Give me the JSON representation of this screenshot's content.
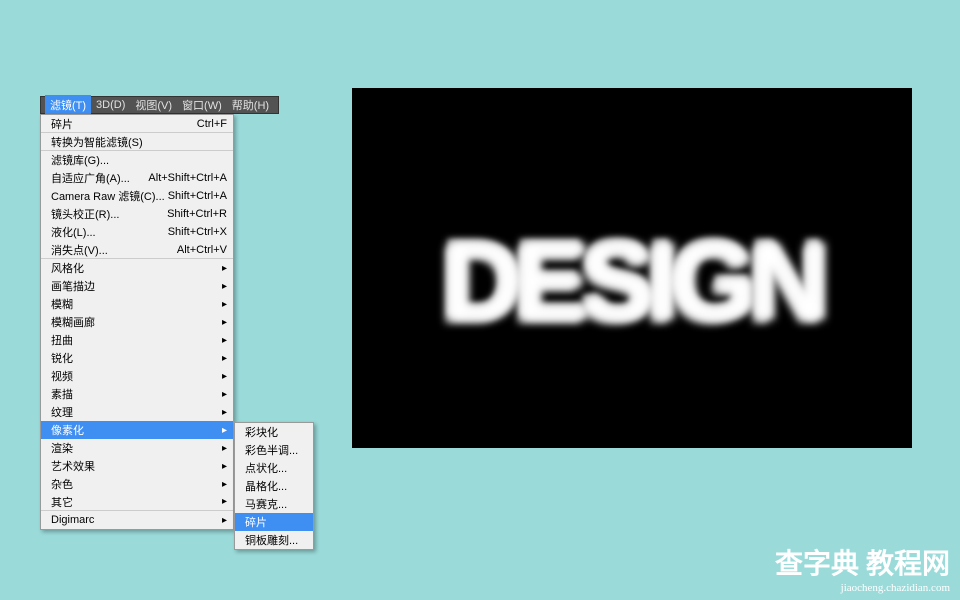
{
  "menubar": {
    "items": [
      "滤镜(T)",
      "3D(D)",
      "视图(V)",
      "窗口(W)",
      "帮助(H)"
    ]
  },
  "dropdown": {
    "items": [
      {
        "label": "碎片",
        "shortcut": "Ctrl+F",
        "arrow": ""
      },
      {
        "label": "转换为智能滤镜(S)",
        "shortcut": "",
        "arrow": ""
      },
      {
        "label": "滤镜库(G)...",
        "shortcut": "",
        "arrow": ""
      },
      {
        "label": "自适应广角(A)...",
        "shortcut": "Alt+Shift+Ctrl+A",
        "arrow": ""
      },
      {
        "label": "Camera Raw 滤镜(C)...",
        "shortcut": "Shift+Ctrl+A",
        "arrow": ""
      },
      {
        "label": "镜头校正(R)...",
        "shortcut": "Shift+Ctrl+R",
        "arrow": ""
      },
      {
        "label": "液化(L)...",
        "shortcut": "Shift+Ctrl+X",
        "arrow": ""
      },
      {
        "label": "消失点(V)...",
        "shortcut": "Alt+Ctrl+V",
        "arrow": ""
      },
      {
        "label": "风格化",
        "shortcut": "",
        "arrow": "▸"
      },
      {
        "label": "画笔描边",
        "shortcut": "",
        "arrow": "▸"
      },
      {
        "label": "模糊",
        "shortcut": "",
        "arrow": "▸"
      },
      {
        "label": "模糊画廊",
        "shortcut": "",
        "arrow": "▸"
      },
      {
        "label": "扭曲",
        "shortcut": "",
        "arrow": "▸"
      },
      {
        "label": "锐化",
        "shortcut": "",
        "arrow": "▸"
      },
      {
        "label": "视频",
        "shortcut": "",
        "arrow": "▸"
      },
      {
        "label": "素描",
        "shortcut": "",
        "arrow": "▸"
      },
      {
        "label": "纹理",
        "shortcut": "",
        "arrow": "▸"
      },
      {
        "label": "像素化",
        "shortcut": "",
        "arrow": "▸"
      },
      {
        "label": "渲染",
        "shortcut": "",
        "arrow": "▸"
      },
      {
        "label": "艺术效果",
        "shortcut": "",
        "arrow": "▸"
      },
      {
        "label": "杂色",
        "shortcut": "",
        "arrow": "▸"
      },
      {
        "label": "其它",
        "shortcut": "",
        "arrow": "▸"
      },
      {
        "label": "Digimarc",
        "shortcut": "",
        "arrow": "▸"
      }
    ],
    "highlighted_index": 17,
    "separators_after": [
      0,
      1,
      7,
      21
    ]
  },
  "submenu": {
    "items": [
      "彩块化",
      "彩色半调...",
      "点状化...",
      "晶格化...",
      "马赛克...",
      "碎片",
      "铜板雕刻..."
    ],
    "highlighted_index": 5
  },
  "canvas": {
    "text": "DESIGN"
  },
  "watermark": {
    "brand": "查字典 教程网",
    "url": "jiaocheng.chazidian.com"
  }
}
